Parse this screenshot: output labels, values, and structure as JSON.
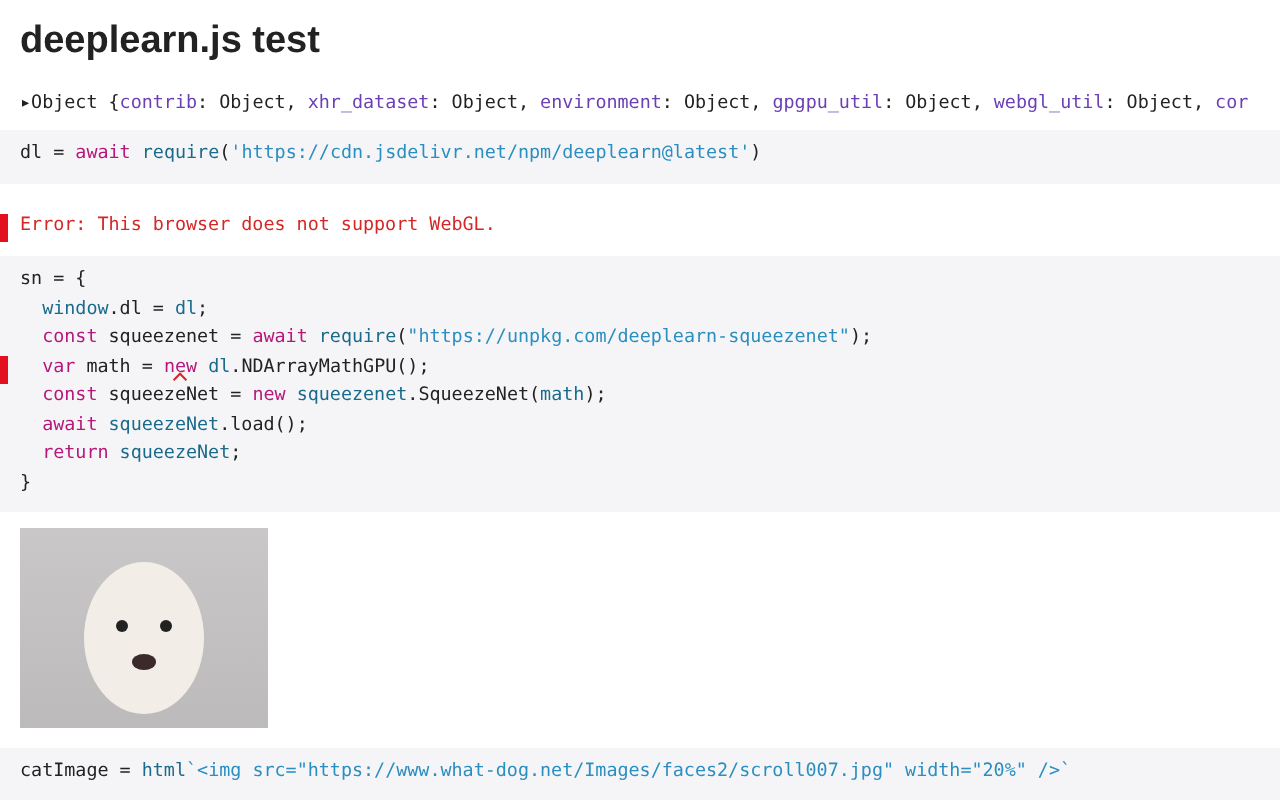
{
  "title": "deeplearn.js test",
  "cells": [
    {
      "kind": "inspector",
      "lines": [
        {
          "error": false,
          "tokens": [
            {
              "kind": "plain",
              "text": "▸Object {"
            },
            {
              "kind": "prop",
              "text": "contrib"
            },
            {
              "kind": "plain",
              "text": ": Object, "
            },
            {
              "kind": "prop",
              "text": "xhr_dataset"
            },
            {
              "kind": "plain",
              "text": ": Object, "
            },
            {
              "kind": "prop",
              "text": "environment"
            },
            {
              "kind": "plain",
              "text": ": Object, "
            },
            {
              "kind": "prop",
              "text": "gpgpu_util"
            },
            {
              "kind": "plain",
              "text": ": Object, "
            },
            {
              "kind": "prop",
              "text": "webgl_util"
            },
            {
              "kind": "plain",
              "text": ": Object, "
            },
            {
              "kind": "prop",
              "text": "cor"
            }
          ]
        }
      ]
    },
    {
      "kind": "code",
      "lines": [
        {
          "error": false,
          "tokens": [
            {
              "kind": "plain",
              "text": "dl = "
            },
            {
              "kind": "keyword",
              "text": "await"
            },
            {
              "kind": "def",
              "text": " require"
            },
            {
              "kind": "plain",
              "text": "("
            },
            {
              "kind": "string",
              "text": "'https://cdn.jsdelivr.net/npm/deeplearn@latest'"
            },
            {
              "kind": "plain",
              "text": ")"
            }
          ]
        }
      ]
    },
    {
      "kind": "error",
      "lines": [
        {
          "error": true,
          "tokens": [
            {
              "kind": "error",
              "text": "Error: This browser does not support WebGL."
            }
          ]
        }
      ]
    },
    {
      "kind": "code",
      "lines": [
        {
          "error": false,
          "tokens": [
            {
              "kind": "plain",
              "text": "sn = {"
            }
          ]
        },
        {
          "error": false,
          "tokens": [
            {
              "kind": "def",
              "text": "  window"
            },
            {
              "kind": "plain",
              "text": ".dl = "
            },
            {
              "kind": "def",
              "text": "dl"
            },
            {
              "kind": "plain",
              "text": ";"
            }
          ]
        },
        {
          "error": false,
          "tokens": [
            {
              "kind": "keyword",
              "text": "  const"
            },
            {
              "kind": "plain",
              "text": " squeezenet = "
            },
            {
              "kind": "keyword",
              "text": "await"
            },
            {
              "kind": "def",
              "text": " require"
            },
            {
              "kind": "plain",
              "text": "("
            },
            {
              "kind": "string",
              "text": "\"https://unpkg.com/deeplearn-squeezenet\""
            },
            {
              "kind": "plain",
              "text": ");"
            }
          ]
        },
        {
          "error": true,
          "tokens": [
            {
              "kind": "keyword",
              "text": "  var"
            },
            {
              "kind": "plain",
              "text": " math = "
            },
            {
              "kind": "keyword",
              "text": "new",
              "lint": true
            },
            {
              "kind": "def",
              "text": " dl"
            },
            {
              "kind": "plain",
              "text": ".NDArrayMathGPU();"
            }
          ]
        },
        {
          "error": false,
          "tokens": [
            {
              "kind": "keyword",
              "text": "  const"
            },
            {
              "kind": "plain",
              "text": " squeezeNet = "
            },
            {
              "kind": "keyword",
              "text": "new"
            },
            {
              "kind": "def",
              "text": " squeezenet"
            },
            {
              "kind": "plain",
              "text": ".SqueezeNet("
            },
            {
              "kind": "def",
              "text": "math"
            },
            {
              "kind": "plain",
              "text": ");"
            }
          ]
        },
        {
          "error": false,
          "tokens": [
            {
              "kind": "keyword",
              "text": "  await"
            },
            {
              "kind": "def",
              "text": " squeezeNet"
            },
            {
              "kind": "plain",
              "text": ".load();"
            }
          ]
        },
        {
          "error": false,
          "tokens": [
            {
              "kind": "keyword",
              "text": "  return"
            },
            {
              "kind": "def",
              "text": " squeezeNet"
            },
            {
              "kind": "plain",
              "text": ";"
            }
          ]
        },
        {
          "error": false,
          "tokens": [
            {
              "kind": "plain",
              "text": "}"
            }
          ]
        }
      ]
    },
    {
      "kind": "image"
    },
    {
      "kind": "code",
      "lines": [
        {
          "error": false,
          "tokens": [
            {
              "kind": "plain",
              "text": "catImage = "
            },
            {
              "kind": "def",
              "text": "html"
            },
            {
              "kind": "string",
              "text": "`<img src=\"https://www.what-dog.net/Images/faces2/scroll007.jpg\" width=\"20%\" />`"
            }
          ]
        }
      ]
    }
  ]
}
